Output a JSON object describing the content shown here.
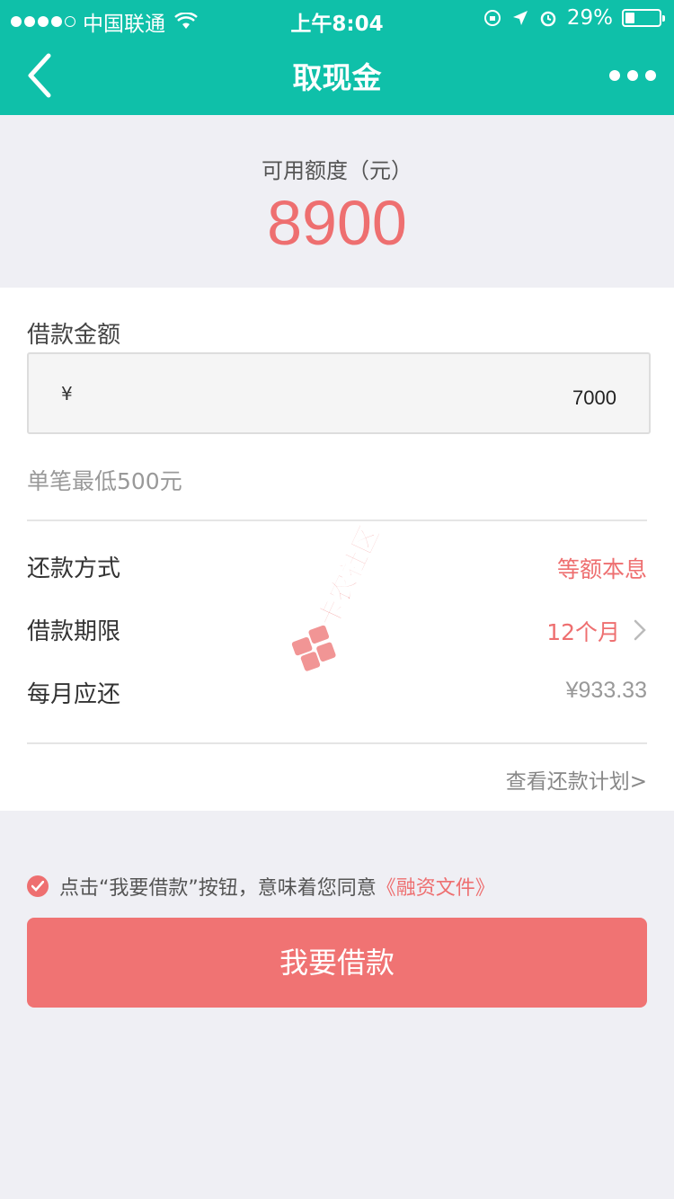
{
  "status_bar": {
    "carrier": "中国联通",
    "time": "上午8:04",
    "battery": "29%",
    "battery_level": 0.29
  },
  "nav": {
    "title": "取现金",
    "back_icon": "chevron-left-icon",
    "more_icon": "more-dots-icon"
  },
  "credit": {
    "label": "可用额度（元）",
    "value": "8900"
  },
  "loan": {
    "label": "借款金额",
    "currency_symbol": "¥",
    "amount": "7000",
    "min_note": "单笔最低500元"
  },
  "details": {
    "repay_method_label": "还款方式",
    "repay_method_value": "等额本息",
    "term_label": "借款期限",
    "term_value": "12个月",
    "monthly_label": "每月应还",
    "monthly_value": "¥933.33",
    "plan_link": "查看还款计划>"
  },
  "agreement": {
    "text": "点击“我要借款”按钮，意味着您同意",
    "link": "《融资文件》"
  },
  "submit_label": "我要借款",
  "watermark": {
    "text": "卡农社区"
  },
  "colors": {
    "header": "#0fc0a9",
    "accent": "#ee6f70",
    "button": "#f07373",
    "background": "#efeff4"
  }
}
